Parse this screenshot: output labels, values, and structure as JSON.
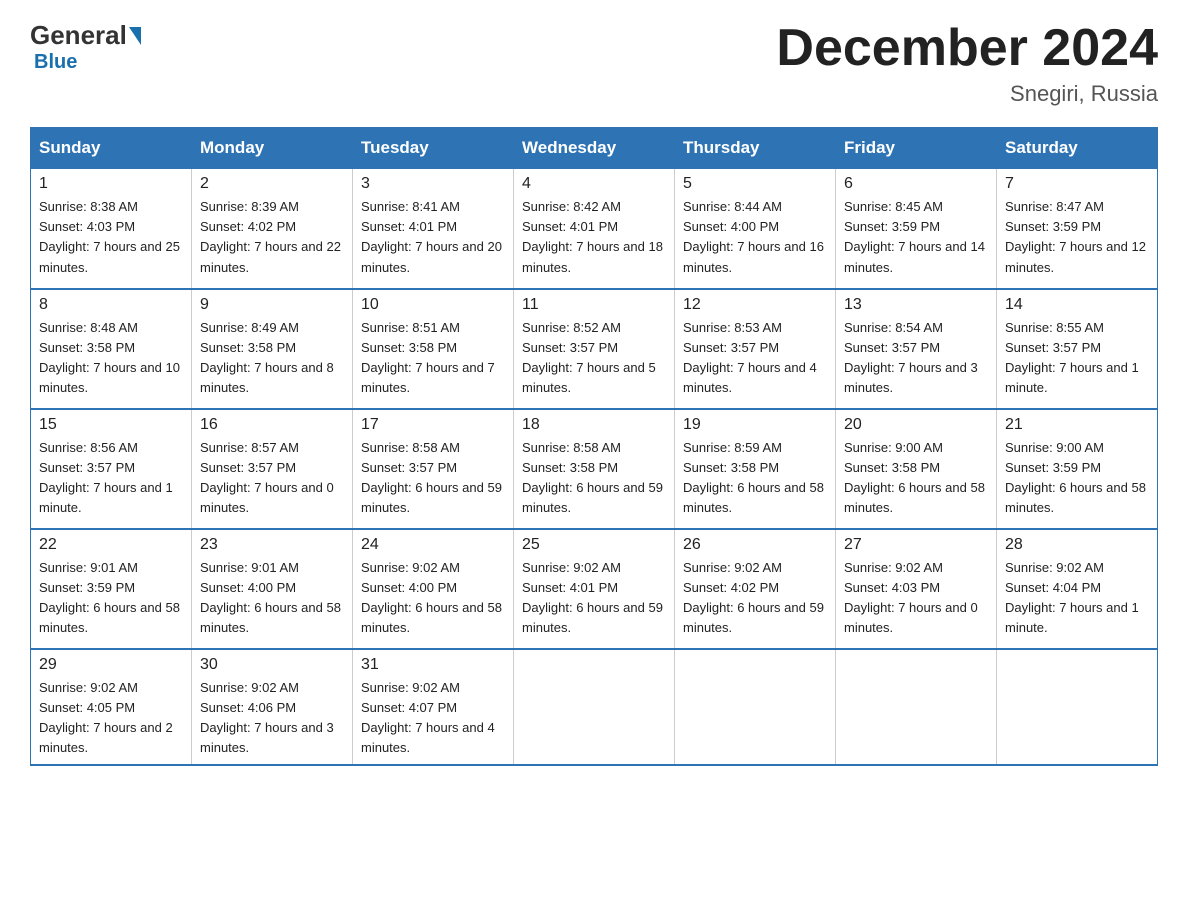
{
  "header": {
    "logo_general": "General",
    "logo_blue": "Blue",
    "main_title": "December 2024",
    "subtitle": "Snegiri, Russia"
  },
  "days_of_week": [
    "Sunday",
    "Monday",
    "Tuesday",
    "Wednesday",
    "Thursday",
    "Friday",
    "Saturday"
  ],
  "weeks": [
    [
      {
        "day": "1",
        "sunrise": "8:38 AM",
        "sunset": "4:03 PM",
        "daylight": "7 hours and 25 minutes."
      },
      {
        "day": "2",
        "sunrise": "8:39 AM",
        "sunset": "4:02 PM",
        "daylight": "7 hours and 22 minutes."
      },
      {
        "day": "3",
        "sunrise": "8:41 AM",
        "sunset": "4:01 PM",
        "daylight": "7 hours and 20 minutes."
      },
      {
        "day": "4",
        "sunrise": "8:42 AM",
        "sunset": "4:01 PM",
        "daylight": "7 hours and 18 minutes."
      },
      {
        "day": "5",
        "sunrise": "8:44 AM",
        "sunset": "4:00 PM",
        "daylight": "7 hours and 16 minutes."
      },
      {
        "day": "6",
        "sunrise": "8:45 AM",
        "sunset": "3:59 PM",
        "daylight": "7 hours and 14 minutes."
      },
      {
        "day": "7",
        "sunrise": "8:47 AM",
        "sunset": "3:59 PM",
        "daylight": "7 hours and 12 minutes."
      }
    ],
    [
      {
        "day": "8",
        "sunrise": "8:48 AM",
        "sunset": "3:58 PM",
        "daylight": "7 hours and 10 minutes."
      },
      {
        "day": "9",
        "sunrise": "8:49 AM",
        "sunset": "3:58 PM",
        "daylight": "7 hours and 8 minutes."
      },
      {
        "day": "10",
        "sunrise": "8:51 AM",
        "sunset": "3:58 PM",
        "daylight": "7 hours and 7 minutes."
      },
      {
        "day": "11",
        "sunrise": "8:52 AM",
        "sunset": "3:57 PM",
        "daylight": "7 hours and 5 minutes."
      },
      {
        "day": "12",
        "sunrise": "8:53 AM",
        "sunset": "3:57 PM",
        "daylight": "7 hours and 4 minutes."
      },
      {
        "day": "13",
        "sunrise": "8:54 AM",
        "sunset": "3:57 PM",
        "daylight": "7 hours and 3 minutes."
      },
      {
        "day": "14",
        "sunrise": "8:55 AM",
        "sunset": "3:57 PM",
        "daylight": "7 hours and 1 minute."
      }
    ],
    [
      {
        "day": "15",
        "sunrise": "8:56 AM",
        "sunset": "3:57 PM",
        "daylight": "7 hours and 1 minute."
      },
      {
        "day": "16",
        "sunrise": "8:57 AM",
        "sunset": "3:57 PM",
        "daylight": "7 hours and 0 minutes."
      },
      {
        "day": "17",
        "sunrise": "8:58 AM",
        "sunset": "3:57 PM",
        "daylight": "6 hours and 59 minutes."
      },
      {
        "day": "18",
        "sunrise": "8:58 AM",
        "sunset": "3:58 PM",
        "daylight": "6 hours and 59 minutes."
      },
      {
        "day": "19",
        "sunrise": "8:59 AM",
        "sunset": "3:58 PM",
        "daylight": "6 hours and 58 minutes."
      },
      {
        "day": "20",
        "sunrise": "9:00 AM",
        "sunset": "3:58 PM",
        "daylight": "6 hours and 58 minutes."
      },
      {
        "day": "21",
        "sunrise": "9:00 AM",
        "sunset": "3:59 PM",
        "daylight": "6 hours and 58 minutes."
      }
    ],
    [
      {
        "day": "22",
        "sunrise": "9:01 AM",
        "sunset": "3:59 PM",
        "daylight": "6 hours and 58 minutes."
      },
      {
        "day": "23",
        "sunrise": "9:01 AM",
        "sunset": "4:00 PM",
        "daylight": "6 hours and 58 minutes."
      },
      {
        "day": "24",
        "sunrise": "9:02 AM",
        "sunset": "4:00 PM",
        "daylight": "6 hours and 58 minutes."
      },
      {
        "day": "25",
        "sunrise": "9:02 AM",
        "sunset": "4:01 PM",
        "daylight": "6 hours and 59 minutes."
      },
      {
        "day": "26",
        "sunrise": "9:02 AM",
        "sunset": "4:02 PM",
        "daylight": "6 hours and 59 minutes."
      },
      {
        "day": "27",
        "sunrise": "9:02 AM",
        "sunset": "4:03 PM",
        "daylight": "7 hours and 0 minutes."
      },
      {
        "day": "28",
        "sunrise": "9:02 AM",
        "sunset": "4:04 PM",
        "daylight": "7 hours and 1 minute."
      }
    ],
    [
      {
        "day": "29",
        "sunrise": "9:02 AM",
        "sunset": "4:05 PM",
        "daylight": "7 hours and 2 minutes."
      },
      {
        "day": "30",
        "sunrise": "9:02 AM",
        "sunset": "4:06 PM",
        "daylight": "7 hours and 3 minutes."
      },
      {
        "day": "31",
        "sunrise": "9:02 AM",
        "sunset": "4:07 PM",
        "daylight": "7 hours and 4 minutes."
      },
      null,
      null,
      null,
      null
    ]
  ]
}
